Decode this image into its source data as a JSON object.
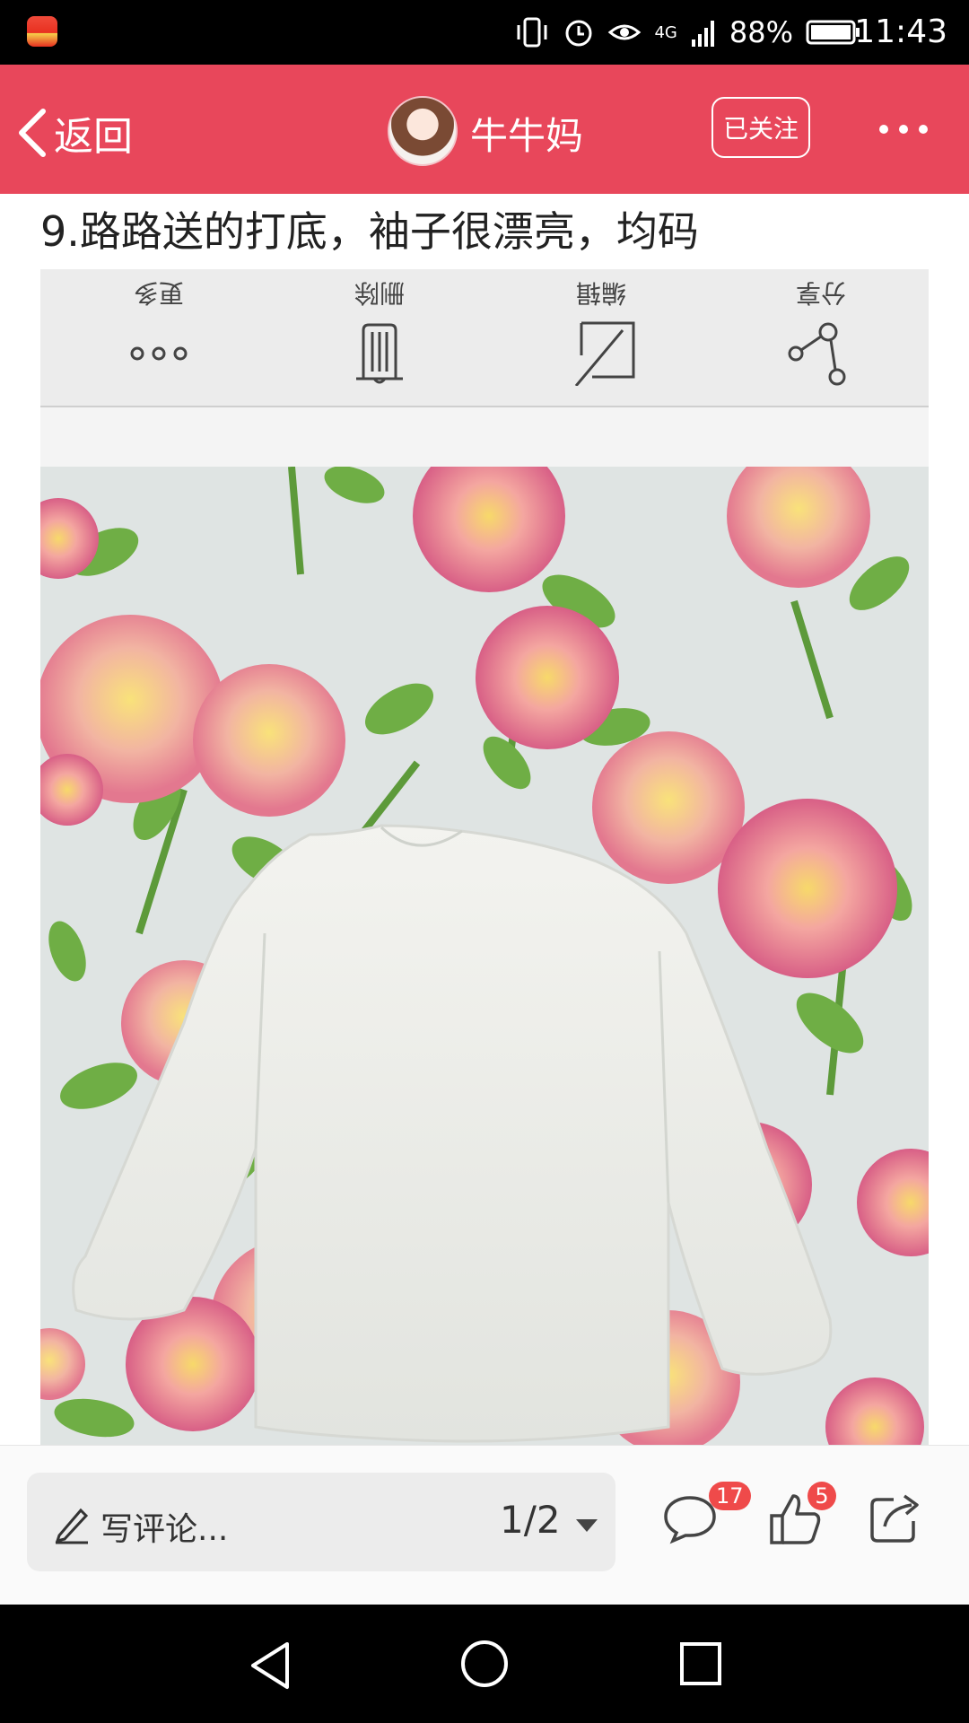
{
  "status_bar": {
    "battery": "88%",
    "network": "4G",
    "time": "11:43"
  },
  "header": {
    "back_label": "返回",
    "username": "牛牛妈",
    "follow_label": "已关注"
  },
  "post": {
    "title": "9.路路送的打底，袖子很漂亮，均码"
  },
  "toolbar": {
    "items": [
      {
        "label": "更多",
        "icon": "more-dots-icon"
      },
      {
        "label": "删除",
        "icon": "trash-icon"
      },
      {
        "label": "编辑",
        "icon": "edit-icon"
      },
      {
        "label": "分享",
        "icon": "share-nodes-icon"
      }
    ]
  },
  "bottom_bar": {
    "comment_placeholder": "写评论...",
    "page_indicator": "1/2",
    "comments_count": "17",
    "likes_count": "5"
  },
  "colors": {
    "header_bg": "#e8475b",
    "badge": "#ef4a4a"
  }
}
